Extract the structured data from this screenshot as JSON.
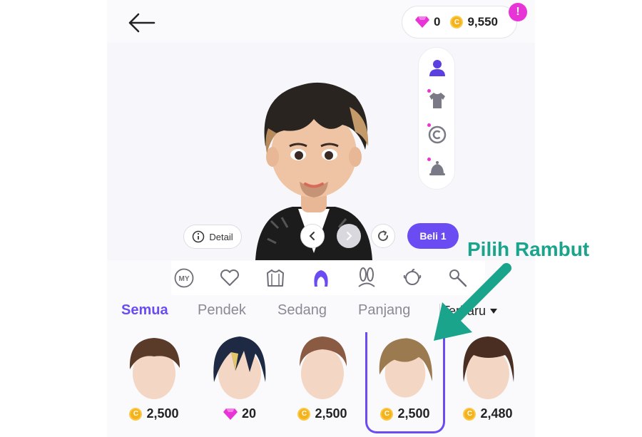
{
  "header": {
    "gems": "0",
    "coins": "9,550",
    "alert_symbol": "!"
  },
  "side_tools": [
    "avatar-icon",
    "shirt-icon",
    "copyright-icon",
    "bell-icon"
  ],
  "controls": {
    "detail_label": "Detail",
    "buy_label": "Beli 1"
  },
  "categories": [
    "my-icon",
    "heart-icon",
    "outfit-icon",
    "hair-icon",
    "bunny-ears-icon",
    "head-icon",
    "microphone-icon"
  ],
  "category_my_text": "MY",
  "filters": {
    "tabs": [
      "Semua",
      "Pendek",
      "Sedang",
      "Panjang"
    ],
    "active": "Semua",
    "sort_label": "Terbaru"
  },
  "items": [
    {
      "currency": "coin",
      "price": "2,500",
      "hair_color": "#5a3b2a"
    },
    {
      "currency": "gem",
      "price": "20",
      "hair_color": "#1e2a44"
    },
    {
      "currency": "coin",
      "price": "2,500",
      "hair_color": "#8b5a42"
    },
    {
      "currency": "coin",
      "price": "2,500",
      "hair_color": "#9c7a4f"
    },
    {
      "currency": "coin",
      "price": "2,480",
      "hair_color": "#4a2e22"
    }
  ],
  "selected_item_index": 3,
  "annotation": {
    "text": "Pilih Rambut",
    "color": "#1aa48c"
  },
  "colors": {
    "accent": "#6b4cf2",
    "gem": "#e834d6",
    "coin": "#f6b21b"
  }
}
